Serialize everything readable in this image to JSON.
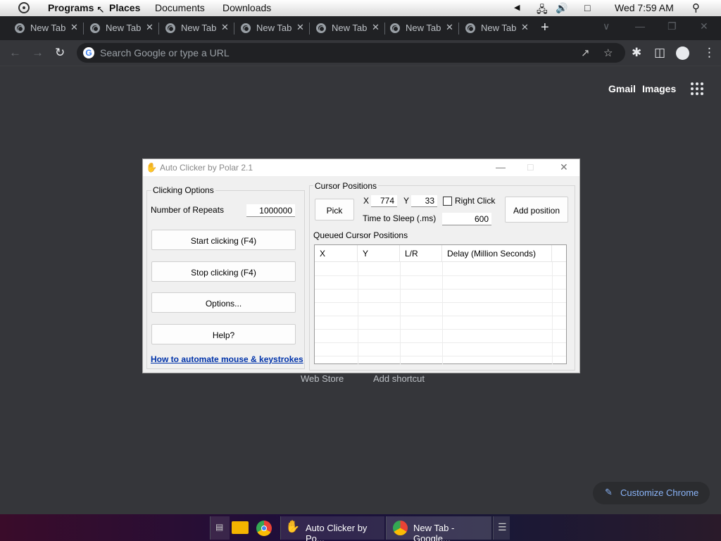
{
  "panel": {
    "menu": [
      "Programs",
      "Places",
      "Documents",
      "Downloads"
    ],
    "clock": "Wed  7:59 AM"
  },
  "tabs": [
    {
      "title": "New Tab"
    },
    {
      "title": "New Tab"
    },
    {
      "title": "New Tab"
    },
    {
      "title": "New Tab"
    },
    {
      "title": "New Tab"
    },
    {
      "title": "New Tab"
    },
    {
      "title": "New Tab"
    }
  ],
  "omnibox": {
    "placeholder": "Search Google or type a URL"
  },
  "ntp": {
    "gmail": "Gmail",
    "images": "Images",
    "shortcuts": [
      "Web Store",
      "Add shortcut"
    ],
    "customize": "Customize Chrome"
  },
  "autoclicker": {
    "title": "Auto Clicker by Polar 2.1",
    "clicking_options": "Clicking Options",
    "repeats_label": "Number of Repeats",
    "repeats_value": "1000000",
    "start": "Start clicking (F4)",
    "stop": "Stop clicking (F4)",
    "options": "Options...",
    "help": "Help?",
    "link": "How to automate mouse & keystrokes",
    "cursor_positions": "Cursor Positions",
    "pick": "Pick",
    "x_label": "X",
    "x_value": "774",
    "y_label": "Y",
    "y_value": "33",
    "right_click": "Right Click",
    "sleep_label": "Time to Sleep (.ms)",
    "sleep_value": "600",
    "add_position": "Add position",
    "queued": "Queued Cursor Positions",
    "columns": [
      "X",
      "Y",
      "L/R",
      "Delay (Million Seconds)"
    ]
  },
  "taskbar": {
    "items": [
      "Auto Clicker by Po...",
      "New Tab - Google..."
    ]
  }
}
